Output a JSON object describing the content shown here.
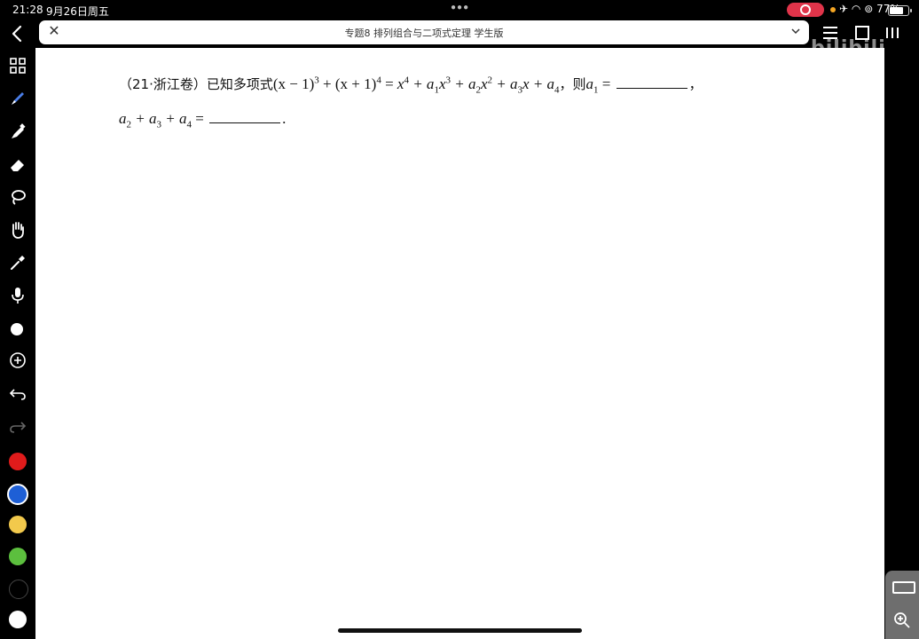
{
  "status_bar": {
    "time": "21:28",
    "date": "9月26日周五",
    "battery_text": "77%",
    "battery_level": 0.77,
    "icons": [
      "recording-icon",
      "airplane-icon",
      "wifi-icon",
      "orientation-lock-icon",
      "battery-icon"
    ]
  },
  "header": {
    "title": "专题8 排列组合与二项式定理 学生版"
  },
  "watermark": {
    "text": "bilibili"
  },
  "toolbar": {
    "tools": [
      "back-icon",
      "thumbnails-icon",
      "pen-icon",
      "highlighter-icon",
      "eraser-icon",
      "lasso-icon",
      "hand-icon",
      "pipette-icon",
      "microphone-icon",
      "shape-icon",
      "add-icon",
      "undo-icon",
      "redo-icon"
    ],
    "colors": [
      "#e01b1b",
      "#1e5fd6",
      "#f2c94c",
      "#5cbf3e",
      "#000000",
      "#ffffff"
    ],
    "selected_color_index": 1
  },
  "problem": {
    "source": "（21·浙江卷）",
    "lead": "已知多项式",
    "line1": {
      "eq_lhs_a": "(x − 1)",
      "exp_a": "3",
      "plus1": " + ",
      "eq_lhs_b": "(x + 1)",
      "exp_b": "4",
      "eq": " = ",
      "x4": "x",
      "exp_x4": "4",
      "t1": " + a",
      "sub1": "1",
      "t1x": "x",
      "exp_t1": "3",
      "t2": " + a",
      "sub2": "2",
      "t2x": "x",
      "exp_t2": "2",
      "t3": " + a",
      "sub3": "3",
      "t3x": "x + a",
      "sub4": "4",
      "then": "，则",
      "a1": "a",
      "a1sub": "1",
      "eq2": " = ",
      "comma": "，"
    },
    "line2": {
      "a2": "a",
      "a2sub": "2",
      "plus_a3": " + a",
      "a3sub": "3",
      "plus_a4": " + a",
      "a4sub": "4",
      "eq": " = ",
      "period": "."
    }
  }
}
